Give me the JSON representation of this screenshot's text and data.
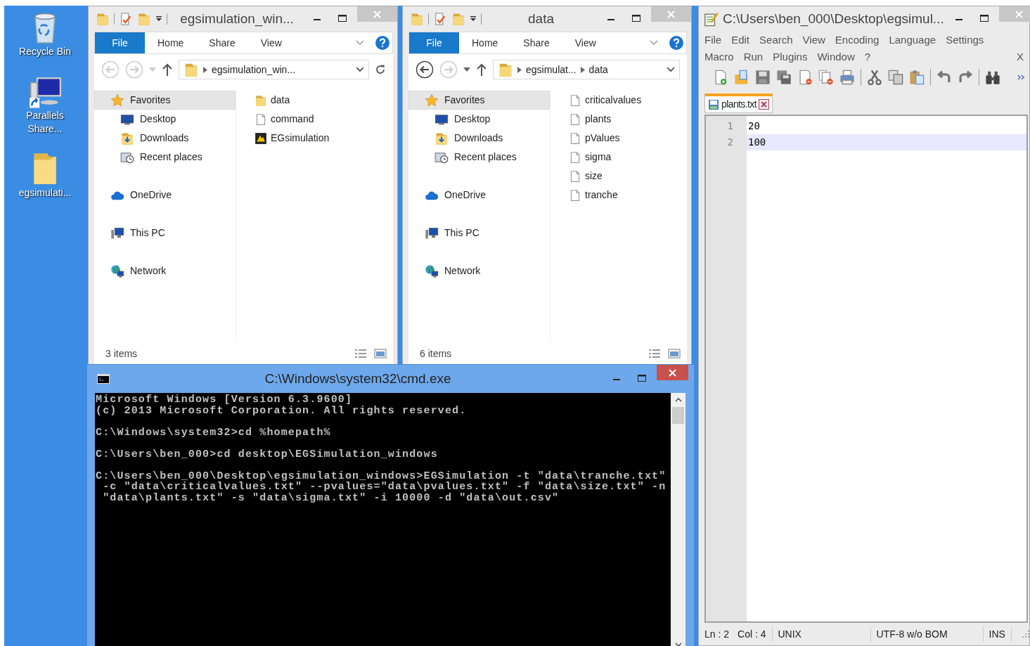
{
  "desktop_icons": [
    {
      "label": "Recycle Bin",
      "kind": "recycle"
    },
    {
      "label": "Parallels Share...",
      "kind": "shortcut"
    },
    {
      "label": "egsimulati...",
      "kind": "folder"
    }
  ],
  "explorers": [
    {
      "title": "egsimulation_win...",
      "active": false,
      "ribbon": [
        {
          "label": "File",
          "kind": "menu"
        },
        {
          "label": "Home",
          "kind": "tab"
        },
        {
          "label": "Share",
          "kind": "tab"
        },
        {
          "label": "View",
          "kind": "tab"
        }
      ],
      "back_enabled": false,
      "breadcrumb": [
        "egsimulation_win..."
      ],
      "refresh": true,
      "nav": [
        {
          "label": "Favorites",
          "kind": "star",
          "selected": true,
          "children": [
            {
              "label": "Desktop",
              "kind": "desktop",
              "selected": false
            },
            {
              "label": "Downloads",
              "kind": "downloads",
              "selected": false
            },
            {
              "label": "Recent places",
              "kind": "recent",
              "selected": false
            }
          ]
        },
        {
          "label": "OneDrive",
          "kind": "cloud",
          "selected": false
        },
        {
          "label": "This PC",
          "kind": "pc",
          "selected": false
        },
        {
          "label": "Network",
          "kind": "network",
          "selected": false
        }
      ],
      "files": [
        {
          "label": "data",
          "kind": "folder"
        },
        {
          "label": "command",
          "kind": "file"
        },
        {
          "label": "EGsimulation",
          "kind": "app"
        }
      ],
      "status": "3 items"
    },
    {
      "title": "data",
      "active": false,
      "ribbon": [
        {
          "label": "File",
          "kind": "menu"
        },
        {
          "label": "Home",
          "kind": "tab"
        },
        {
          "label": "Share",
          "kind": "tab"
        },
        {
          "label": "View",
          "kind": "tab"
        }
      ],
      "back_enabled": true,
      "breadcrumb": [
        "egsimulat...",
        "data"
      ],
      "refresh": false,
      "nav": [
        {
          "label": "Favorites",
          "kind": "star",
          "selected": true,
          "children": [
            {
              "label": "Desktop",
              "kind": "desktop",
              "selected": false
            },
            {
              "label": "Downloads",
              "kind": "downloads",
              "selected": false
            },
            {
              "label": "Recent places",
              "kind": "recent",
              "selected": false
            }
          ]
        },
        {
          "label": "OneDrive",
          "kind": "cloud",
          "selected": false
        },
        {
          "label": "This PC",
          "kind": "pc",
          "selected": false
        },
        {
          "label": "Network",
          "kind": "network",
          "selected": false
        }
      ],
      "files": [
        {
          "label": "criticalvalues",
          "kind": "file"
        },
        {
          "label": "plants",
          "kind": "file"
        },
        {
          "label": "pValues",
          "kind": "file"
        },
        {
          "label": "sigma",
          "kind": "file"
        },
        {
          "label": "size",
          "kind": "file"
        },
        {
          "label": "tranche",
          "kind": "file"
        }
      ],
      "status": "6 items"
    }
  ],
  "notepad": {
    "title": "C:\\Users\\ben_000\\Desktop\\egsimul...",
    "active": false,
    "menu_rows": [
      [
        "File",
        "Edit",
        "Search",
        "View",
        "Encoding",
        "Language",
        "Settings"
      ],
      [
        "Macro",
        "Run",
        "Plugins",
        "Window",
        "?"
      ]
    ],
    "close_doc": "X",
    "tabs": [
      {
        "label": "plants.txt",
        "selected": true
      }
    ],
    "lines": [
      {
        "number": "1",
        "text": "20",
        "current": false
      },
      {
        "number": "2",
        "text": "100",
        "current": true
      }
    ],
    "status_cells": [
      [
        "Ln : 2",
        "Col : 4"
      ],
      [
        "UNIX"
      ],
      [
        "UTF-8 w/o BOM"
      ],
      [
        "INS"
      ]
    ]
  },
  "cmd": {
    "title": "C:\\Windows\\system32\\cmd.exe",
    "active": true,
    "blocks": [
      [
        "Microsoft Windows [Version 6.3.9600]",
        "(c) 2013 Microsoft Corporation. All rights reserved."
      ],
      [
        "C:\\Windows\\system32>cd %homepath%"
      ],
      [
        "C:\\Users\\ben_000>cd desktop\\EGSimulation_windows"
      ],
      [
        "C:\\Users\\ben_000\\Desktop\\egsimulation_windows>EGSimulation -t \"data\\tranche.txt\"",
        " -c \"data\\criticalvalues.txt\" --pvalues=\"data\\pvalues.txt\" -f \"data\\size.txt\" -n",
        " \"data\\plants.txt\" -s \"data\\sigma.txt\" -i 10000 -d \"data\\out.csv\""
      ]
    ]
  }
}
